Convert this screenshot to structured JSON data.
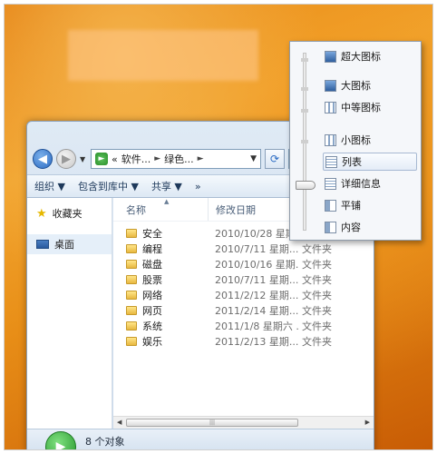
{
  "address": {
    "prefix": "«",
    "segments": [
      "软件...",
      "绿色..."
    ],
    "search_placeholder": "搜索"
  },
  "toolbar": {
    "organize": "组织 ▼",
    "include_library": "包含到库中 ▼",
    "share": "共享 ▼",
    "more": "»"
  },
  "navpane": {
    "favorites": "收藏夹",
    "desktop": "桌面"
  },
  "columns": {
    "name": "名称",
    "date": "修改日期"
  },
  "files": [
    {
      "name": "安全",
      "date": "2010/10/28 星期...",
      "type": "文件夹"
    },
    {
      "name": "编程",
      "date": "2010/7/11 星期...",
      "type": "文件夹"
    },
    {
      "name": "磁盘",
      "date": "2010/10/16 星期...",
      "type": "文件夹"
    },
    {
      "name": "股票",
      "date": "2010/7/11 星期...",
      "type": "文件夹"
    },
    {
      "name": "网络",
      "date": "2011/2/12 星期...",
      "type": "文件夹"
    },
    {
      "name": "网页",
      "date": "2011/2/14 星期...",
      "type": "文件夹"
    },
    {
      "name": "系统",
      "date": "2011/1/8 星期六 ...",
      "type": "文件夹"
    },
    {
      "name": "娱乐",
      "date": "2011/2/13 星期...",
      "type": "文件夹"
    }
  ],
  "status": {
    "count": "8 个对象"
  },
  "viewmenu": {
    "items": [
      {
        "label": "超大图标",
        "icon": "extra-large-icons-icon"
      },
      {
        "label": "大图标",
        "icon": "large-icons-icon"
      },
      {
        "label": "中等图标",
        "icon": "medium-icons-icon"
      },
      {
        "label": "小图标",
        "icon": "small-icons-icon"
      },
      {
        "label": "列表",
        "icon": "list-view-icon"
      },
      {
        "label": "详细信息",
        "icon": "details-view-icon"
      },
      {
        "label": "平铺",
        "icon": "tiles-view-icon"
      },
      {
        "label": "内容",
        "icon": "content-view-icon"
      }
    ],
    "active_label": "列表"
  }
}
